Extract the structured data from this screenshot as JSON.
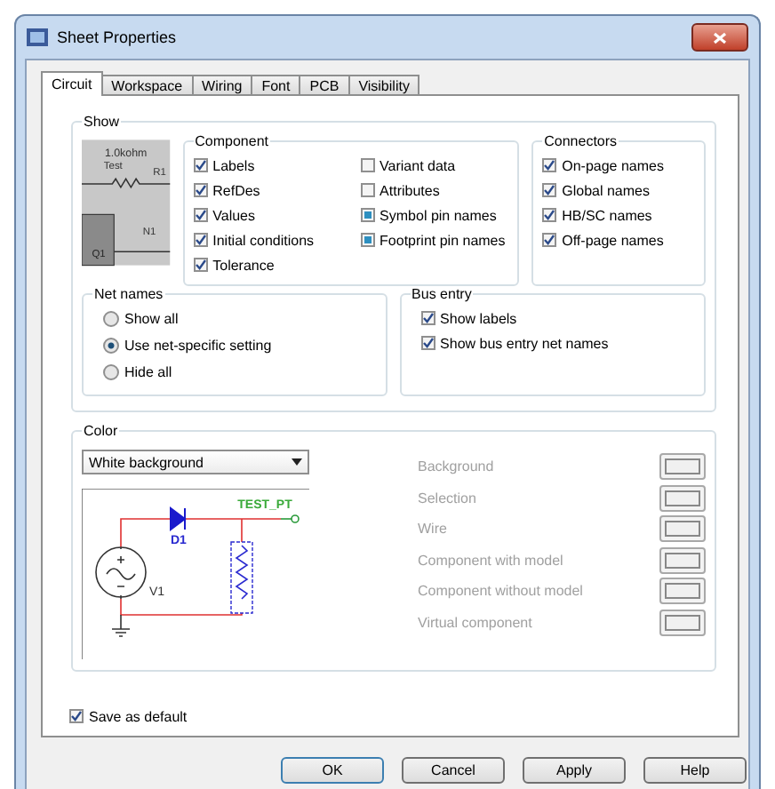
{
  "window": {
    "title": "Sheet Properties"
  },
  "tabs": [
    {
      "label": "Circuit",
      "selected": true
    },
    {
      "label": "Workspace",
      "selected": false
    },
    {
      "label": "Wiring",
      "selected": false
    },
    {
      "label": "Font",
      "selected": false
    },
    {
      "label": "PCB",
      "selected": false
    },
    {
      "label": "Visibility",
      "selected": false
    }
  ],
  "show": {
    "title": "Show",
    "preview_labels": {
      "value": "1.0kohm",
      "label": "Test",
      "refdes": "R1",
      "net": "N1",
      "transistor": "Q1"
    },
    "component": {
      "title": "Component",
      "items": [
        {
          "label": "Labels",
          "kind": "check",
          "checked": true
        },
        {
          "label": "RefDes",
          "kind": "check",
          "checked": true
        },
        {
          "label": "Values",
          "kind": "check",
          "checked": true
        },
        {
          "label": "Initial conditions",
          "kind": "check",
          "checked": true
        },
        {
          "label": "Tolerance",
          "kind": "check",
          "checked": true
        },
        {
          "label": "Variant data",
          "kind": "check",
          "checked": false
        },
        {
          "label": "Attributes",
          "kind": "check",
          "checked": false
        },
        {
          "label": "Symbol pin names",
          "kind": "tristate",
          "checked": true
        },
        {
          "label": "Footprint pin names",
          "kind": "tristate",
          "checked": true
        }
      ]
    },
    "connectors": {
      "title": "Connectors",
      "items": [
        {
          "label": "On-page names",
          "checked": true
        },
        {
          "label": "Global names",
          "checked": true
        },
        {
          "label": "HB/SC names",
          "checked": true
        },
        {
          "label": "Off-page names",
          "checked": true
        }
      ]
    },
    "net_names": {
      "title": "Net names",
      "options": [
        {
          "label": "Show all",
          "selected": false
        },
        {
          "label": "Use net-specific setting",
          "selected": true
        },
        {
          "label": "Hide all",
          "selected": false
        }
      ]
    },
    "bus_entry": {
      "title": "Bus entry",
      "items": [
        {
          "label": "Show labels",
          "checked": true
        },
        {
          "label": "Show bus entry net names",
          "checked": true
        }
      ]
    }
  },
  "color": {
    "title": "Color",
    "scheme": "White background",
    "preview_labels": {
      "probe": "TEST_PT",
      "diode": "D1",
      "source": "V1"
    },
    "items": [
      {
        "label": "Background",
        "disabled": true
      },
      {
        "label": "Selection",
        "disabled": true
      },
      {
        "label": "Wire",
        "disabled": true
      },
      {
        "label": "Component with model",
        "disabled": true
      },
      {
        "label": "Component without model",
        "disabled": true
      },
      {
        "label": "Virtual component",
        "disabled": true
      }
    ]
  },
  "save_default": {
    "label": "Save as default",
    "checked": true
  },
  "buttons": [
    {
      "label": "OK",
      "default": true
    },
    {
      "label": "Cancel",
      "default": false
    },
    {
      "label": "Apply",
      "default": false
    },
    {
      "label": "Help",
      "default": false
    }
  ]
}
